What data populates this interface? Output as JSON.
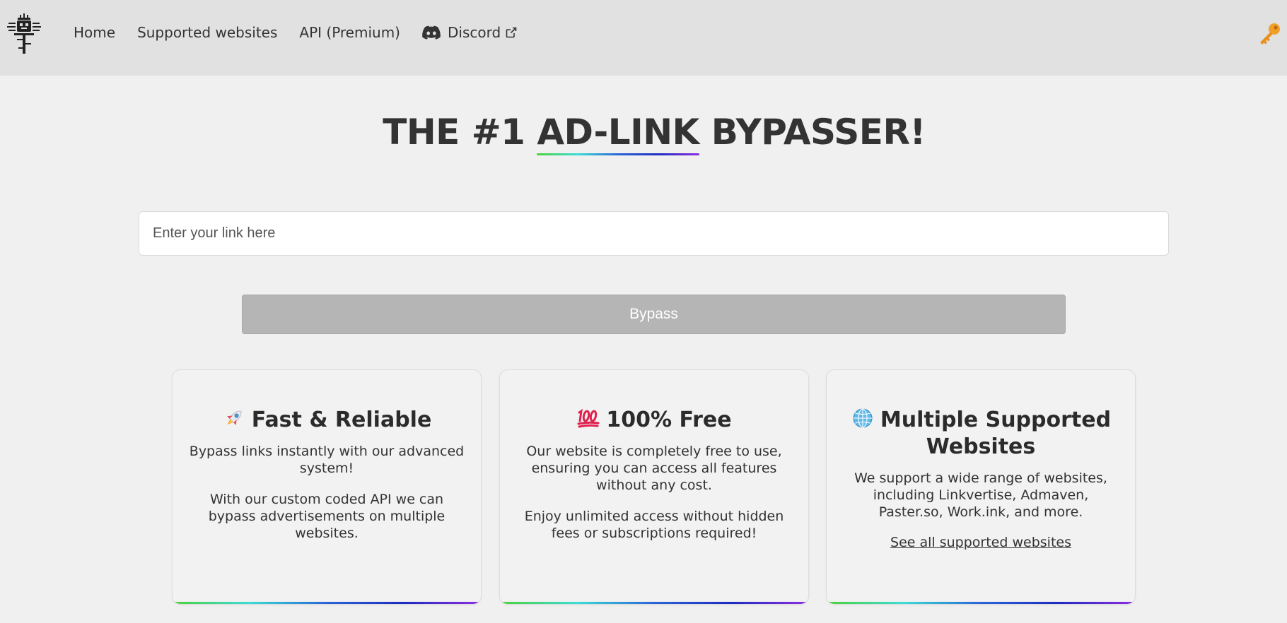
{
  "nav": {
    "items": [
      {
        "label": "Home"
      },
      {
        "label": "Supported websites"
      },
      {
        "label": "API (Premium)"
      },
      {
        "label": "Discord"
      }
    ]
  },
  "hero": {
    "title_before": "THE #1 ",
    "title_accent": "AD-LINK",
    "title_after": " BYPASSER!"
  },
  "form": {
    "link_placeholder": "Enter your link here",
    "link_value": "",
    "bypass_label": "Bypass"
  },
  "cards": [
    {
      "icon": "rocket-icon",
      "title": "Fast & Reliable",
      "paragraphs": [
        "Bypass links instantly with our advanced system!",
        "With our custom coded API we can bypass advertisements on multiple websites."
      ]
    },
    {
      "icon": "hundred-points-icon",
      "title": "100% Free",
      "paragraphs": [
        "Our website is completely free to use, ensuring you can access all features without any cost.",
        "Enjoy unlimited access without hidden fees or subscriptions required!"
      ]
    },
    {
      "icon": "globe-icon",
      "title": "Multiple Supported Websites",
      "paragraphs": [
        "We support a wide range of websites, including Linkvertise, Admaven, Paster.so, Work.ink, and more."
      ],
      "link_label": "See all supported websites"
    }
  ],
  "colors": {
    "navbar_bg": "#e1e1e1",
    "page_bg": "#f0f0f0",
    "button_bg": "#b5b5b5",
    "gradient_start": "#4cd137",
    "gradient_mid": "#2a64d8",
    "gradient_end": "#8e2de2"
  }
}
